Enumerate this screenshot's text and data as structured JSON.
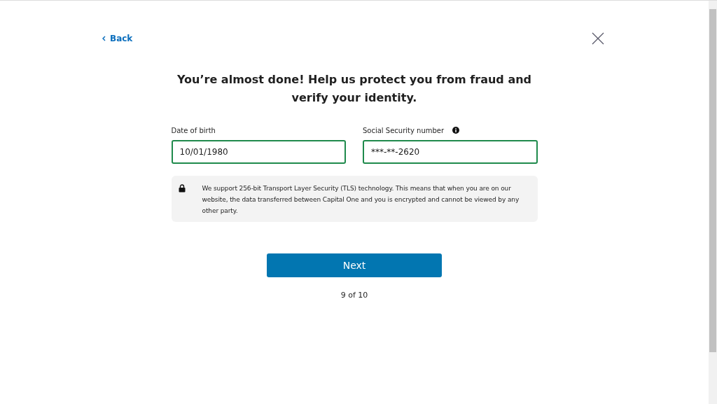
{
  "back_link": {
    "label": "Back"
  },
  "title": "You’re almost done! Help us protect you from fraud and verify your identity.",
  "fields": [
    {
      "label": "Date of birth",
      "value": "10/01/1980",
      "info": false
    },
    {
      "label": "Social Security number",
      "value": "***-**-2620",
      "info": true
    }
  ],
  "notice": "We support 256-bit Transport Layer Security (TLS) technology. This means that when you are on our website, the data transferred between Capital One and you is encrypted and cannot be viewed by any other party.",
  "next_button": "Next",
  "progress": "9 of 10"
}
